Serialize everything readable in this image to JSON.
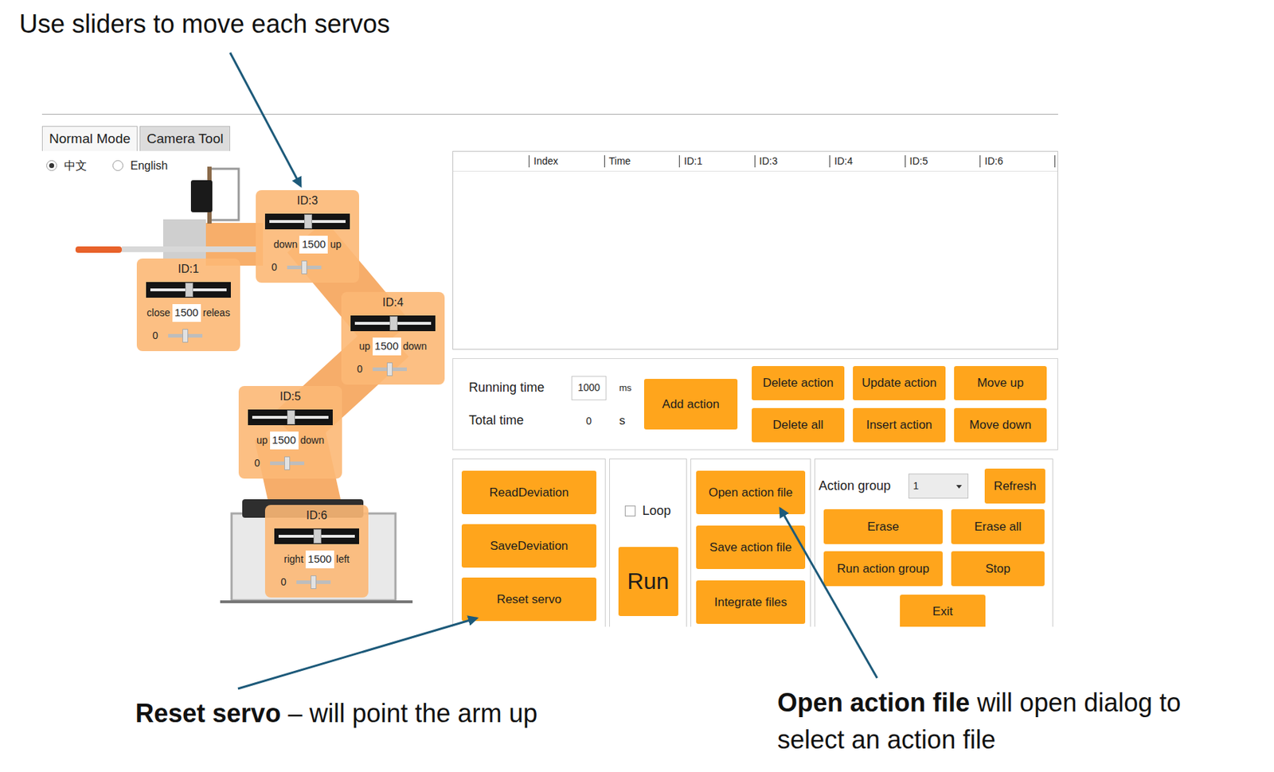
{
  "annotations": {
    "sliders": "Use sliders to move each servos",
    "reset": {
      "bold": "Reset servo",
      "rest": "– will point the arm up"
    },
    "open_file": {
      "bold": "Open action file",
      "rest": "will open dialog to select an action file"
    }
  },
  "tabs": [
    {
      "label": "Normal Mode",
      "selected": true
    },
    {
      "label": "Camera Tool",
      "selected": false
    }
  ],
  "languages": [
    {
      "label": "中文",
      "selected": true
    },
    {
      "label": "English",
      "selected": false
    }
  ],
  "servos": [
    {
      "id": "ID:3",
      "left_label": "down",
      "right_label": "up",
      "value": "1500",
      "level": 0.5,
      "deviation": "0",
      "deviation_level": 0.5
    },
    {
      "id": "ID:1",
      "left_label": "close",
      "right_label": "releas",
      "value": "1500",
      "level": 0.5,
      "deviation": "0",
      "deviation_level": 0.5
    },
    {
      "id": "ID:4",
      "left_label": "up",
      "right_label": "down",
      "value": "1500",
      "level": 0.5,
      "deviation": "0",
      "deviation_level": 0.5
    },
    {
      "id": "ID:5",
      "left_label": "up",
      "right_label": "down",
      "value": "1500",
      "level": 0.5,
      "deviation": "0",
      "deviation_level": 0.5
    },
    {
      "id": "ID:6",
      "left_label": "right",
      "right_label": "left",
      "value": "1500",
      "level": 0.5,
      "deviation": "0",
      "deviation_level": 0.5
    }
  ],
  "table": {
    "columns": [
      "Index",
      "Time",
      "ID:1",
      "ID:3",
      "ID:4",
      "ID:5",
      "ID:6"
    ],
    "rows": []
  },
  "timing": {
    "running_label": "Running time",
    "running_value": "1000",
    "running_unit": "ms",
    "total_label": "Total time",
    "total_value": "0",
    "total_unit": "s"
  },
  "add_action": "Add action",
  "edit_buttons": [
    "Delete action",
    "Update action",
    "Move up",
    "Delete all",
    "Insert action",
    "Move down"
  ],
  "deviation_buttons": [
    "ReadDeviation",
    "SaveDeviation",
    "Reset servo"
  ],
  "run": {
    "loop_label": "Loop",
    "loop_checked": false,
    "button": "Run"
  },
  "file_buttons": [
    "Open action file",
    "Save action file",
    "Integrate files"
  ],
  "action_group": {
    "label": "Action group",
    "value": "1",
    "refresh": "Refresh",
    "buttons": [
      "Erase",
      "Erase all",
      "Run action group",
      "Stop"
    ],
    "exit": "Exit"
  }
}
